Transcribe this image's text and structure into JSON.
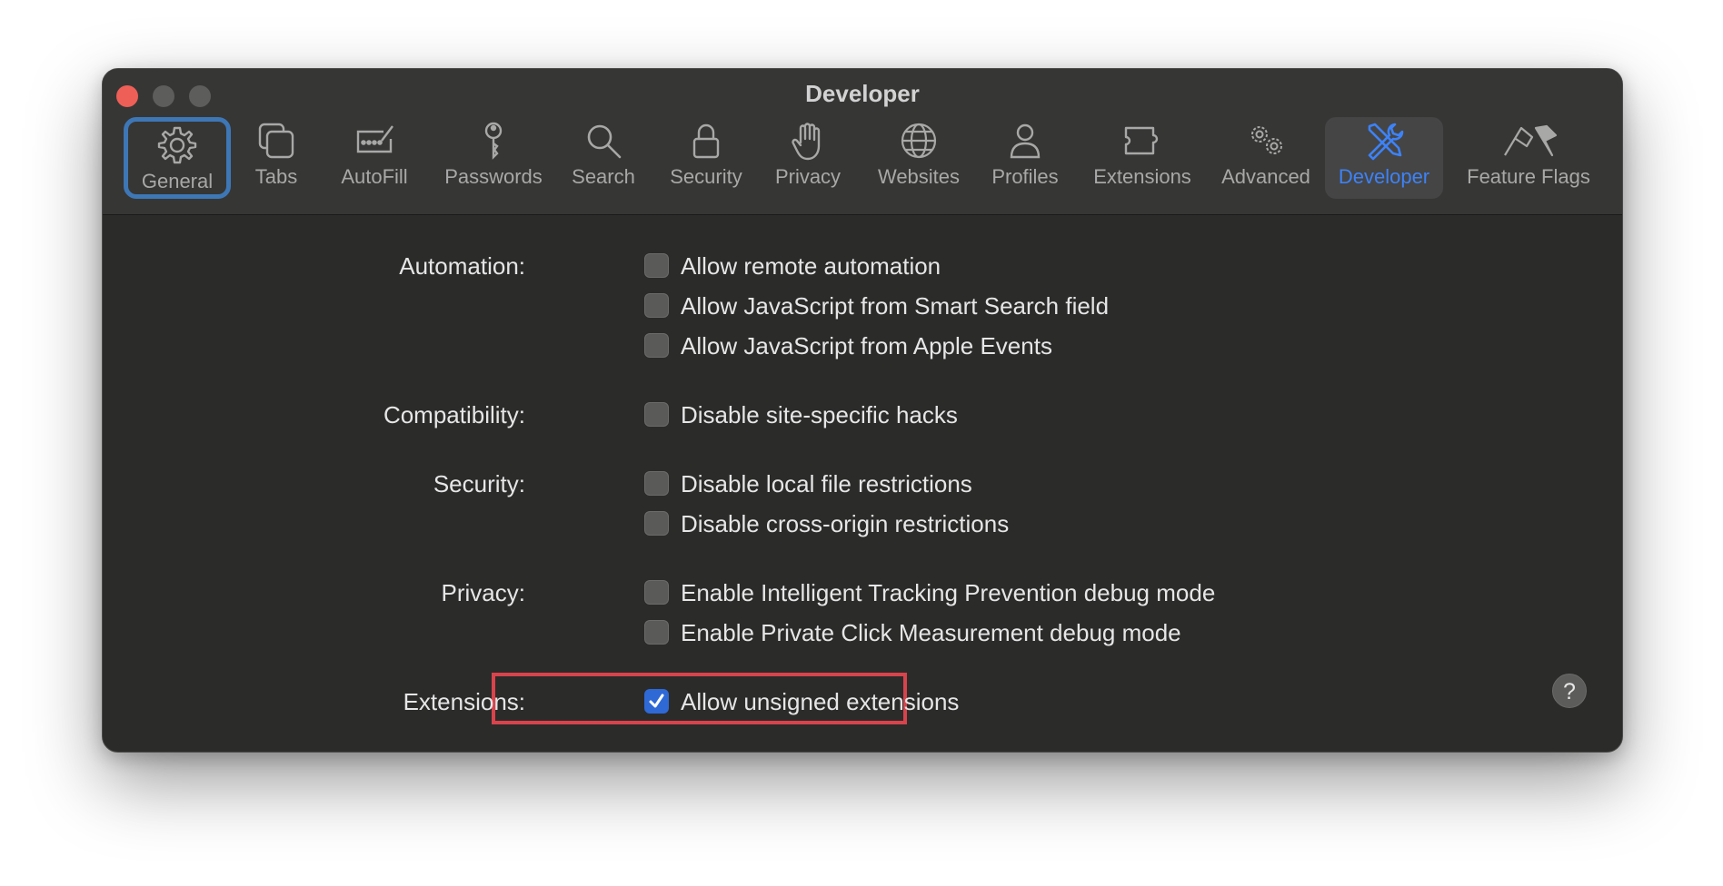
{
  "window": {
    "title": "Developer"
  },
  "toolbar": {
    "tabs": [
      {
        "label": "General",
        "icon": "gear-icon"
      },
      {
        "label": "Tabs",
        "icon": "tabs-icon"
      },
      {
        "label": "AutoFill",
        "icon": "autofill-icon"
      },
      {
        "label": "Passwords",
        "icon": "key-icon"
      },
      {
        "label": "Search",
        "icon": "magnifier-icon"
      },
      {
        "label": "Security",
        "icon": "lock-icon"
      },
      {
        "label": "Privacy",
        "icon": "hand-icon"
      },
      {
        "label": "Websites",
        "icon": "globe-icon"
      },
      {
        "label": "Profiles",
        "icon": "person-icon"
      },
      {
        "label": "Extensions",
        "icon": "puzzle-icon"
      },
      {
        "label": "Advanced",
        "icon": "gears-icon"
      },
      {
        "label": "Developer",
        "icon": "tools-icon"
      },
      {
        "label": "Feature Flags",
        "icon": "flags-icon"
      }
    ],
    "selected": "Developer",
    "focused": "General",
    "accent_color": "#3d82f7"
  },
  "sections": {
    "automation": {
      "label": "Automation:",
      "options": [
        {
          "label": "Allow remote automation",
          "checked": false
        },
        {
          "label": "Allow JavaScript from Smart Search field",
          "checked": false
        },
        {
          "label": "Allow JavaScript from Apple Events",
          "checked": false
        }
      ]
    },
    "compatibility": {
      "label": "Compatibility:",
      "options": [
        {
          "label": "Disable site-specific hacks",
          "checked": false
        }
      ]
    },
    "security": {
      "label": "Security:",
      "options": [
        {
          "label": "Disable local file restrictions",
          "checked": false
        },
        {
          "label": "Disable cross-origin restrictions",
          "checked": false
        }
      ]
    },
    "privacy": {
      "label": "Privacy:",
      "options": [
        {
          "label": "Enable Intelligent Tracking Prevention debug mode",
          "checked": false
        },
        {
          "label": "Enable Private Click Measurement debug mode",
          "checked": false
        }
      ]
    },
    "extensions": {
      "label": "Extensions:",
      "options": [
        {
          "label": "Allow unsigned extensions",
          "checked": true
        }
      ]
    }
  },
  "help": {
    "label": "?"
  },
  "colors": {
    "highlight_border": "#d9434c",
    "checkbox_checked": "#2e69d6"
  }
}
